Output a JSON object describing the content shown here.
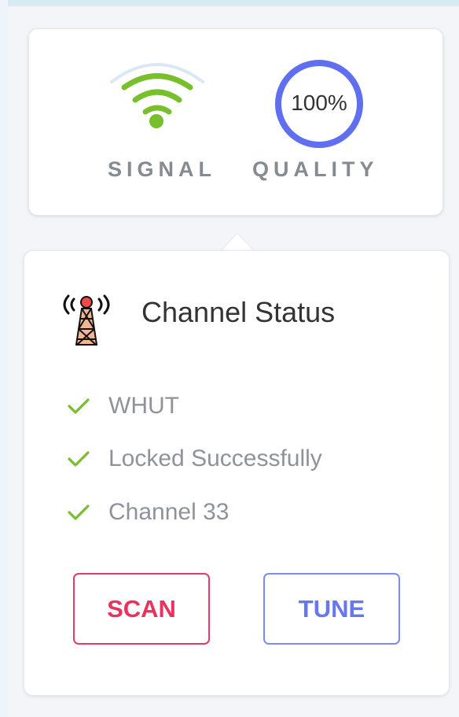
{
  "signal": {
    "label": "SIGNAL",
    "icon": "wifi-signal-icon",
    "arc_color": "#dbe7f3",
    "color": "#77bf2d"
  },
  "quality": {
    "label": "QUALITY",
    "value": "100%",
    "ring_color": "#5f6ff0"
  },
  "channel": {
    "title": "Channel Status",
    "icon": "broadcast-tower-icon",
    "statuses": [
      {
        "text": "WHUT"
      },
      {
        "text": "Locked Successfully"
      },
      {
        "text": "Channel 33"
      }
    ]
  },
  "actions": {
    "scan_label": "SCAN",
    "tune_label": "TUNE",
    "scan_color": "#e43c66",
    "tune_color": "#7b8af4"
  }
}
